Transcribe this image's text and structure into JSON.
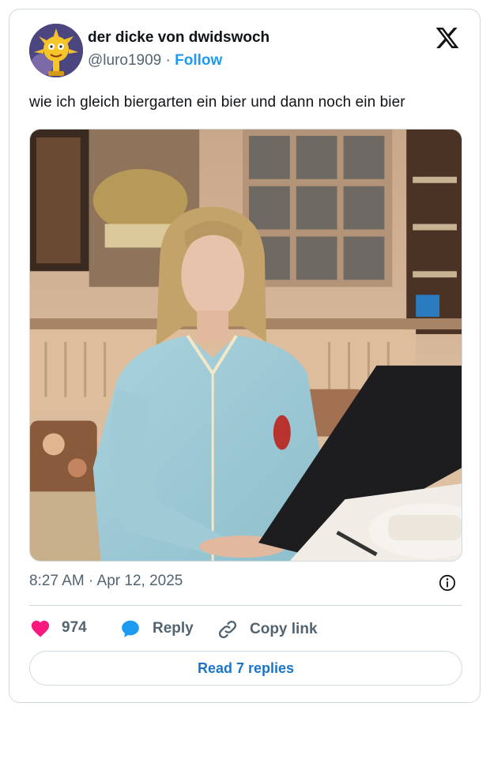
{
  "author": {
    "display_name": "der dicke von dwidswoch",
    "handle": "@luro1909",
    "separator": " · ",
    "follow_label": "Follow",
    "avatar_icon": "cartoon-sun-avatar"
  },
  "platform_icon": "x-logo-icon",
  "tweet": {
    "text": "wie ich gleich biergarten ein bier und dann noch ein bier",
    "timestamp": "8:27 AM · Apr 12, 2025"
  },
  "actions": {
    "likes_count": "974",
    "reply_label": "Reply",
    "copy_label": "Copy link"
  },
  "read_replies_label": "Read 7 replies",
  "colors": {
    "accent": "#1d9bf0",
    "like": "#f91880",
    "text": "#0f1419",
    "muted": "#536471",
    "border": "#cfd9de"
  }
}
